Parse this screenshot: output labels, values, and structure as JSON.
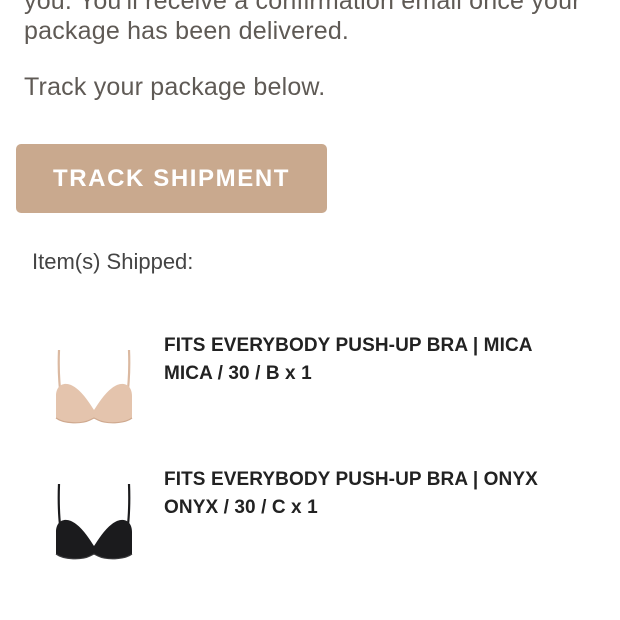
{
  "email": {
    "intro_line_1": "you. You'll receive a confirmation email once your",
    "intro_line_2": "package has been delivered.",
    "track_text": "Track your package below.",
    "track_button_label": "TRACK SHIPMENT",
    "items_heading": "Item(s) Shipped:",
    "items": [
      {
        "title": "FITS EVERYBODY PUSH-UP BRA | MICA",
        "variant": "MICA / 30 / B x 1",
        "color": "#e4c4ad"
      },
      {
        "title": "FITS EVERYBODY PUSH-UP BRA | ONYX",
        "variant": "ONYX / 30 / C x 1",
        "color": "#1b1b1d"
      }
    ]
  },
  "colors": {
    "button_background": "#c9a98e",
    "body_text": "#5f5a55"
  }
}
